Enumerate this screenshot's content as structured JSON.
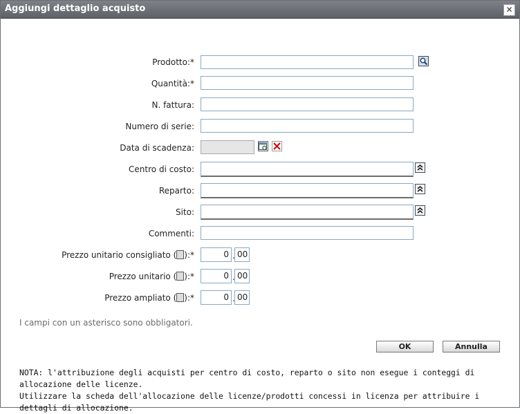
{
  "dialog": {
    "title": "Aggiungi dettaglio acquisto",
    "close_glyph": "✕"
  },
  "fields": {
    "prodotto": {
      "label": "Prodotto:",
      "req": "*",
      "value": ""
    },
    "quantita": {
      "label": "Quantità:",
      "req": "*",
      "value": ""
    },
    "fattura": {
      "label": "N. fattura:",
      "value": ""
    },
    "serie": {
      "label": "Numero di serie:",
      "value": ""
    },
    "scadenza": {
      "label": "Data di scadenza:",
      "value": ""
    },
    "centro": {
      "label": "Centro di costo:",
      "value": ""
    },
    "reparto": {
      "label": "Reparto:",
      "value": ""
    },
    "sito": {
      "label": "Sito:",
      "value": ""
    },
    "commenti": {
      "label": "Commenti:",
      "value": ""
    }
  },
  "prices": {
    "consigliato": {
      "label_before": "Prezzo unitario consigliato (",
      "label_after": "):",
      "req": "*",
      "int": "0",
      "dec": "00"
    },
    "unitario": {
      "label_before": "Prezzo unitario (",
      "label_after": "):",
      "req": "*",
      "int": "0",
      "dec": "00"
    },
    "ampliato": {
      "label_before": "Prezzo ampliato (",
      "label_after": "):",
      "req": "*",
      "int": "0",
      "dec": "00"
    },
    "separator": "."
  },
  "required_note": "I campi con un asterisco sono obbligatori.",
  "buttons": {
    "ok": "OK",
    "cancel": "Annulla"
  },
  "nota": {
    "line1": "NOTA: l'attribuzione degli acquisti per centro di costo, reparto o sito non esegue i conteggi di allocazione delle licenze.",
    "line2": "Utilizzare la scheda dell'allocazione delle licenze/prodotti concessi in licenza per attribuire i dettagli di allocazione."
  },
  "icons": {
    "search": "search-icon",
    "calendar": "calendar-icon",
    "clear": "clear-date-icon",
    "expand": "expand-up-icon",
    "currency": "currency-icon"
  }
}
